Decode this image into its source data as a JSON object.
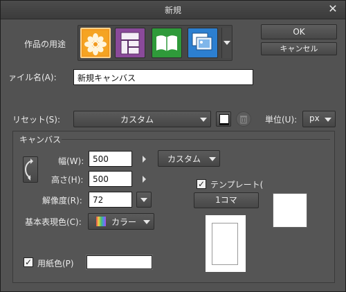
{
  "window": {
    "title": "新規",
    "close_glyph": "✕"
  },
  "usage": {
    "label": "作品の用途",
    "icons": [
      "illustration-icon",
      "comic-icon",
      "book-icon",
      "animation-icon"
    ]
  },
  "actions": {
    "ok": "OK",
    "cancel": "キャンセル"
  },
  "filename": {
    "label": "ァイル名(A):",
    "value": "新規キャンバス"
  },
  "preset": {
    "label": "リセット(S):",
    "value": "カスタム"
  },
  "unit": {
    "label": "単位(U):",
    "value": "px"
  },
  "canvas": {
    "section_title": "キャンバス",
    "width_label": "幅(W):",
    "width_value": "500",
    "height_label": "高さ(H):",
    "height_value": "500",
    "resolution_label": "解像度(R):",
    "resolution_value": "72",
    "size_preset": "カスタム",
    "color_label": "基本表現色(C):",
    "color_value": "カラー"
  },
  "template": {
    "label": "テンプレート(",
    "checked": true,
    "pages": "1コマ"
  },
  "paper": {
    "label": "用紙色(P)",
    "checked": true,
    "color": "#ffffff"
  },
  "colors": {
    "accent_selected": "#f29a1f",
    "panel": "#525252"
  }
}
